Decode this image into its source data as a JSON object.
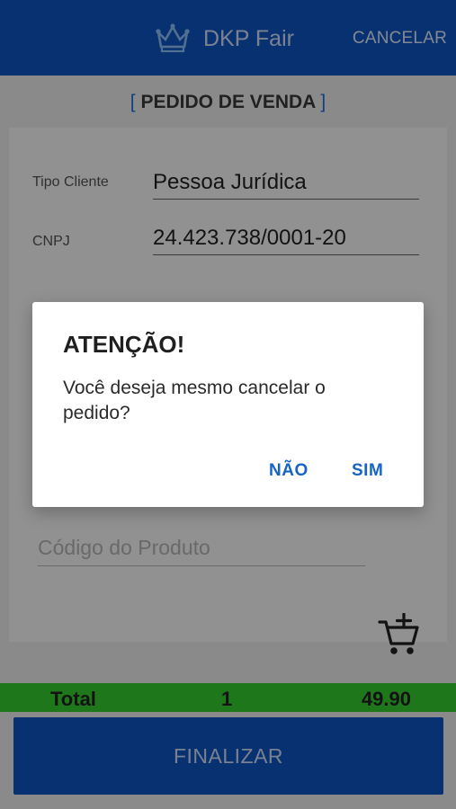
{
  "app_bar": {
    "title": "DKP Fair",
    "cancel_label": "CANCELAR",
    "icon": "crown-icon"
  },
  "section": {
    "title": "PEDIDO DE VENDA",
    "left_bracket": "[",
    "right_bracket": "]"
  },
  "form": {
    "customer_type_label": "Tipo Cliente",
    "customer_type_value": "Pessoa Jurídica",
    "cnpj_label": "CNPJ",
    "cnpj_value": "24.423.738/0001-20",
    "product_code_placeholder": "Código do Produto",
    "add_to_cart_icon": "add-to-cart-icon"
  },
  "totals": {
    "label": "Total",
    "quantity": "1",
    "amount": "49.90"
  },
  "footer": {
    "finalize_label": "FINALIZAR"
  },
  "dialog": {
    "title": "ATENÇÃO!",
    "message": "Você deseja mesmo cancelar o pedido?",
    "no_label": "NÃO",
    "yes_label": "SIM"
  },
  "colors": {
    "primary": "#0f57c7",
    "accent": "#1f6fe6",
    "total_bar": "#38d132",
    "dialog_button": "#1564c6"
  }
}
